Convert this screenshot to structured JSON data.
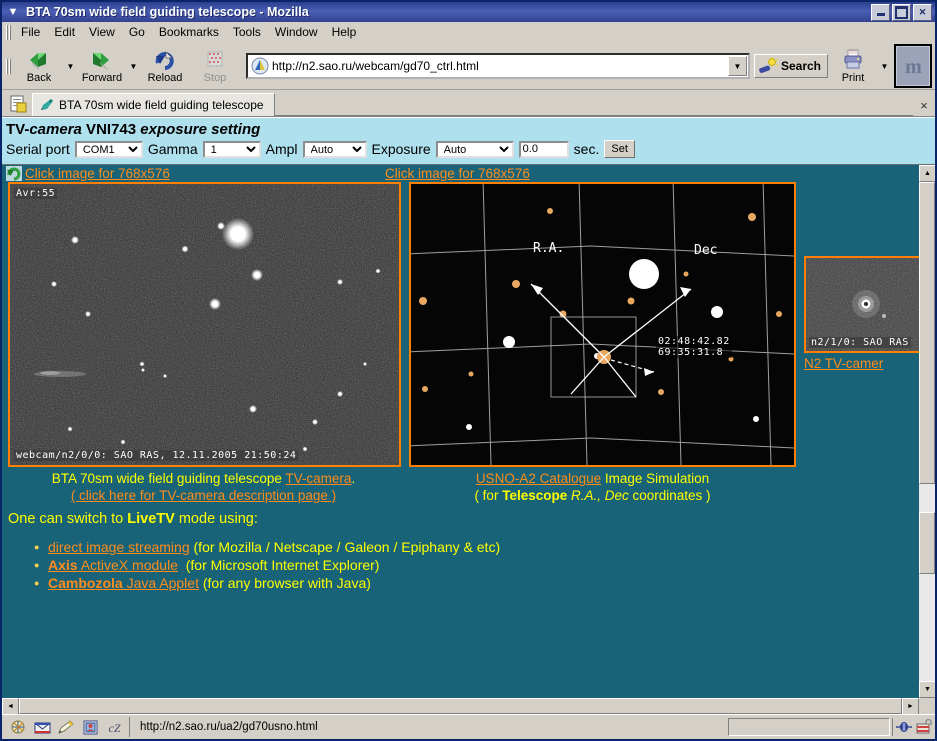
{
  "window": {
    "title": "BTA 70sm wide field guiding telescope - Mozilla",
    "minimize": "–",
    "maximize": "□",
    "close": "✕"
  },
  "menu": [
    "File",
    "Edit",
    "View",
    "Go",
    "Bookmarks",
    "Tools",
    "Window",
    "Help"
  ],
  "toolbar": {
    "back": "Back",
    "forward": "Forward",
    "reload": "Reload",
    "stop": "Stop",
    "url": "http://n2.sao.ru/webcam/gd70_ctrl.html",
    "search": "Search",
    "print": "Print",
    "logo": "m",
    "dropdown_caret": "▼"
  },
  "tabs": {
    "label": "BTA 70sm wide field guiding telescope",
    "close": "×"
  },
  "control_panel": {
    "title_pre": "TV-",
    "title_mid": "camera",
    "title_model": " VNI743 ",
    "title_post": "exposure setting",
    "serial_port_label": "Serial port",
    "serial_port_value": "COM1",
    "gamma_label": "Gamma",
    "gamma_value": "1",
    "ampl_label": "Ampl",
    "ampl_value": "Auto",
    "exposure_label": "Exposure",
    "exposure_value": "Auto",
    "exposure_seconds": "0.0",
    "seconds_label": "sec.",
    "set_button": "Set"
  },
  "page": {
    "link_left": "Click image for 768x576",
    "link_right": "Click image for 768x576",
    "cam_overlay_avr": "Avr:55",
    "cam_overlay_footer": "webcam/n2/0/0: SAO RAS, 12.11.2005 21:50:24",
    "chart_label_ra": "R.A.",
    "chart_label_dec": "Dec",
    "chart_coord_ra": "02:48:42.82",
    "chart_coord_dec": "69:35:31.8",
    "thumb_overlay": "n2/1/0: SAO RAS",
    "thumb_link": "N2 TV-camer",
    "caption_left_1_pre": "BTA 70sm wide field guiding telescope ",
    "caption_left_1_link": "TV-camera",
    "caption_left_1_post": ".",
    "caption_left_2": "( click here for TV-camera description page )",
    "caption_right_1_link": "USNO-A2 Catalogue",
    "caption_right_1_post": " Image Simulation",
    "caption_right_2_open": "( for ",
    "caption_right_2_bold": "Telescope",
    "caption_right_2_italic": " R.A., Dec",
    "caption_right_2_close": " coordinates )",
    "livetv_pre": "One can switch to ",
    "livetv_bold": "LiveTV",
    "livetv_post": " mode using:",
    "livetv_items": [
      {
        "link": "direct image streaming",
        "note": "(for Mozilla / Netscape / Galeon / Epiphany & etc)"
      },
      {
        "link_bold": "Axis",
        "link": " ActiveX module",
        "note": "(for Microsoft Internet Explorer)"
      },
      {
        "link_bold": "Cambozola",
        "link": " Java Applet",
        "note": "(for any browser with Java)"
      }
    ]
  },
  "statusbar": {
    "url": "http://n2.sao.ru/ua2/gd70usno.html"
  },
  "colors": {
    "page_bg": "#186377",
    "panel_bg": "#aee0ee",
    "link": "#ff8c1a",
    "text": "#ffff00",
    "image_border": "#ff7f00",
    "titlebar": "#2b3f8c"
  },
  "scroll": {
    "up": "▲",
    "down": "▼",
    "left": "◄",
    "right": "►"
  }
}
